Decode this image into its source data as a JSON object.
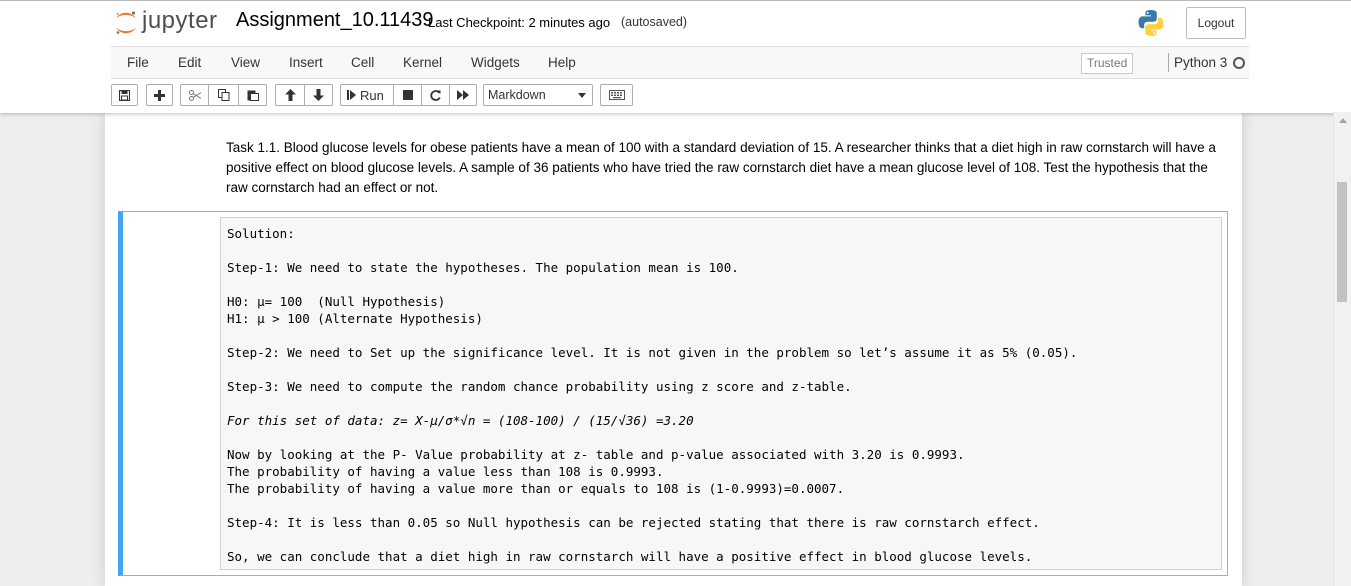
{
  "header": {
    "logo_text": "jupyter",
    "notebook_title": "Assignment_10.11439",
    "checkpoint": "Last Checkpoint: 2 minutes ago",
    "autosave_status": "(autosaved)",
    "logout_label": "Logout"
  },
  "menubar": {
    "items": [
      "File",
      "Edit",
      "View",
      "Insert",
      "Cell",
      "Kernel",
      "Widgets",
      "Help"
    ],
    "trusted_label": "Trusted",
    "kernel_name": "Python 3"
  },
  "toolbar": {
    "run_label": "Run",
    "cell_type": "Markdown",
    "icons": [
      "save-icon",
      "plus-icon",
      "scissors-icon",
      "copy-icon",
      "paste-icon",
      "arrow-up-icon",
      "arrow-down-icon",
      "step-forward-icon",
      "stop-icon",
      "restart-icon",
      "fast-forward-icon",
      "keyboard-icon"
    ]
  },
  "cells": {
    "task_text": "Task 1.1. Blood glucose levels for obese patients have a mean of 100 with a standard deviation of 15. A researcher thinks that a diet high in raw cornstarch will have a positive effect on blood glucose levels. A sample of 36 patients who have tried the raw cornstarch diet have a mean glucose level of 108. Test the hypothesis that the raw cornstarch had an effect or not.",
    "solution_lines": [
      "Solution:",
      "",
      "Step-1: We need to state the hypotheses. The population mean is 100.",
      "",
      "H0: µ= 100  (Null Hypothesis)",
      "H1: µ > 100 (Alternate Hypothesis)",
      "",
      "Step-2: We need to Set up the significance level. It is not given in the problem so let’s assume it as 5% (0.05).",
      "",
      "Step-3: We need to compute the random chance probability using z score and z-table.",
      "",
      "For this set of data: z= X-µ/σ*√n = (108-100) / (15/√36) =3.20",
      "",
      "Now by looking at the P- Value probability at z- table and p-value associated with 3.20 is 0.9993.",
      "The probability of having a value less than 108 is 0.9993.",
      "The probability of having a value more than or equals to 108 is (1-0.9993)=0.0007.",
      "",
      "Step-4: It is less than 0.05 so Null hypothesis can be rejected stating that there is raw cornstarch effect.",
      "",
      "So, we can conclude that a diet high in raw cornstarch will have a positive effect in blood glucose levels."
    ]
  },
  "colors": {
    "jupyter_orange": "#f37626",
    "selected_cell_border": "#42a5f5"
  }
}
